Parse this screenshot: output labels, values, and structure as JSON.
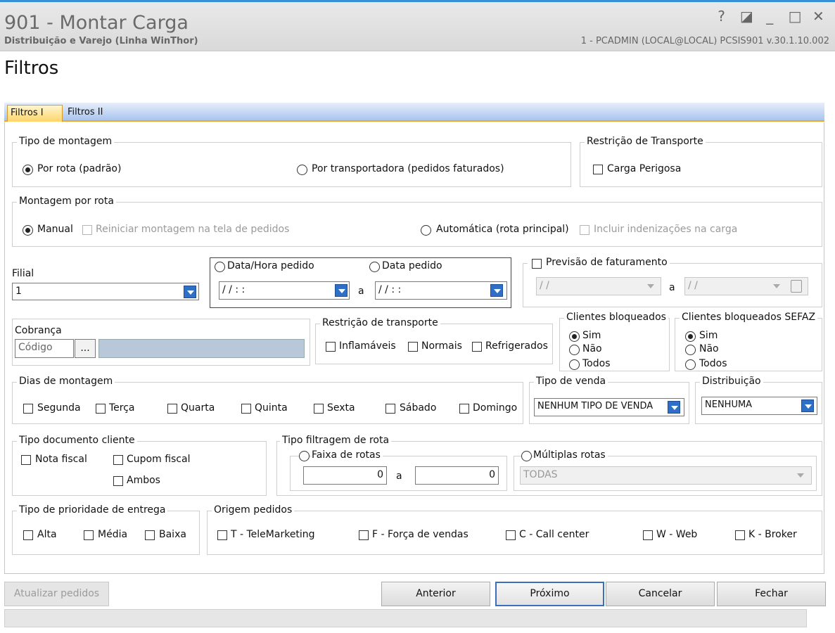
{
  "window": {
    "title": "901 - Montar Carga",
    "subtitle": "Distribuição e Varejo (Linha WinThor)",
    "info": "1 - PCADMIN (LOCAL@LOCAL)  PCSIS901  v.30.1.10.002",
    "controls": {
      "help": "?",
      "restore_alt": "◪",
      "minimize": "_",
      "maximize": "□",
      "close": "✕"
    }
  },
  "page": {
    "heading": "Filtros"
  },
  "tabs": [
    {
      "label": "Filtros I"
    },
    {
      "label": "Filtros II"
    }
  ],
  "tipo_montagem": {
    "legend": "Tipo de montagem",
    "por_rota": "Por rota (padrão)",
    "por_transportadora": "Por transportadora (pedidos faturados)"
  },
  "restricao_transporte_top": {
    "legend": "Restrição de Transporte",
    "carga_perigosa": "Carga Perigosa"
  },
  "montagem_rota": {
    "legend": "Montagem por rota",
    "manual": "Manual",
    "reiniciar": "Reiniciar montagem na tela de pedidos",
    "automatica": "Automática (rota principal)",
    "incluir": "Incluir indenizações na carga"
  },
  "filial": {
    "label": "Filial",
    "value": "1"
  },
  "data": {
    "data_hora": "Data/Hora pedido",
    "data_pedido": "Data pedido",
    "from": "/ /     : :",
    "sep": "a",
    "to": "/ /     : :"
  },
  "previsao": {
    "label": "Previsão de faturamento",
    "from": "/ /",
    "sep": "a",
    "to": "/ /"
  },
  "cobranca": {
    "label": "Cobrança",
    "placeholder": "Código",
    "ellipsis": "..."
  },
  "restricao_transporte": {
    "legend": "Restrição de transporte",
    "inflamaveis": "Inflamáveis",
    "normais": "Normais",
    "refrigerados": "Refrigerados"
  },
  "clientes_bloqueados": {
    "legend": "Clientes bloqueados",
    "sim": "Sim",
    "nao": "Não",
    "todos": "Todos"
  },
  "clientes_bloqueados_sefaz": {
    "legend": "Clientes bloqueados SEFAZ",
    "sim": "Sim",
    "nao": "Não",
    "todos": "Todos"
  },
  "dias": {
    "legend": "Dias de montagem",
    "segunda": "Segunda",
    "terca": "Terça",
    "quarta": "Quarta",
    "quinta": "Quinta",
    "sexta": "Sexta",
    "sabado": "Sábado",
    "domingo": "Domingo"
  },
  "tipo_venda": {
    "legend": "Tipo de venda",
    "value": "NENHUM TIPO DE VENDA"
  },
  "distribuicao": {
    "legend": "Distribuição",
    "value": "NENHUMA"
  },
  "tipo_documento": {
    "legend": "Tipo documento cliente",
    "nota_fiscal": "Nota fiscal",
    "cupom_fiscal": "Cupom fiscal",
    "ambos": "Ambos"
  },
  "filtragem_rota": {
    "legend": "Tipo filtragem de rota",
    "faixa": "Faixa de rotas",
    "from": "0",
    "sep": "a",
    "to": "0",
    "multiplas": "Múltiplas rotas",
    "multiplas_value": "TODAS"
  },
  "prioridade": {
    "legend": "Tipo de prioridade de  entrega",
    "alta": "Alta",
    "media": "Média",
    "baixa": "Baixa"
  },
  "origem": {
    "legend": "Origem pedidos",
    "t": "T - TeleMarketing",
    "f": "F - Força de vendas",
    "c": "C - Call center",
    "w": "W - Web",
    "k": "K - Broker"
  },
  "buttons": {
    "atualizar": "Atualizar pedidos",
    "anterior": "Anterior",
    "proximo": "Próximo",
    "cancelar": "Cancelar",
    "fechar": "Fechar"
  }
}
